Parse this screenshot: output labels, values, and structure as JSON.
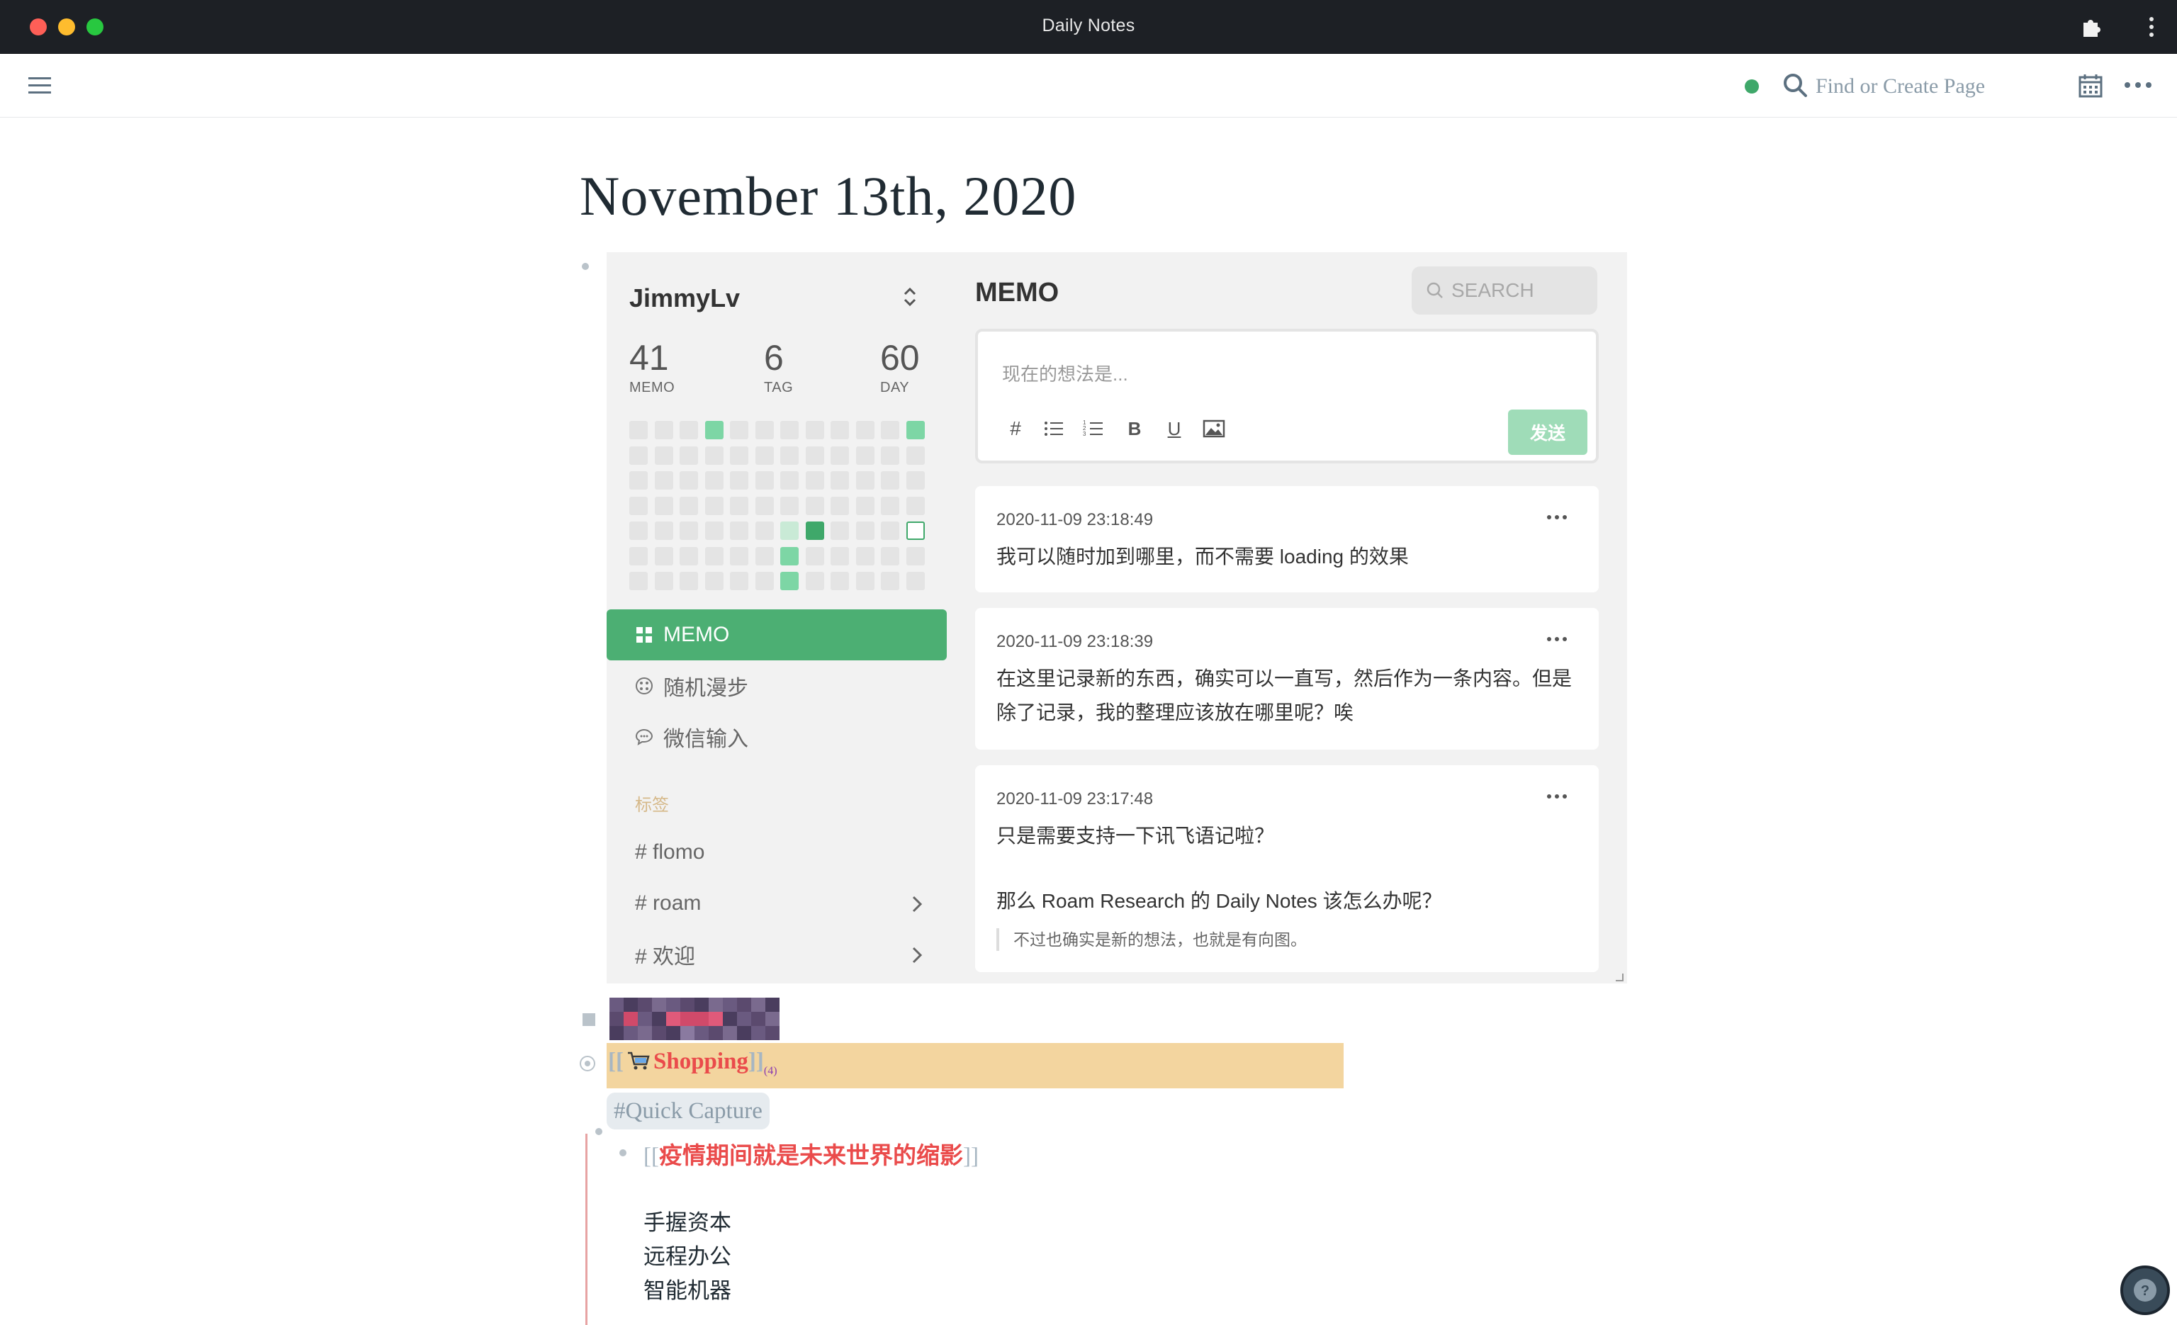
{
  "window": {
    "title": "Daily Notes"
  },
  "topbar": {
    "search_placeholder": "Find or Create Page"
  },
  "page": {
    "title": "November 13th, 2020"
  },
  "flomo": {
    "user": "JimmyLv",
    "stats": [
      {
        "value": "41",
        "label": "MEMO"
      },
      {
        "value": "6",
        "label": "TAG"
      },
      {
        "value": "60",
        "label": "DAY"
      }
    ],
    "heatmap": {
      "rows": 7,
      "cols": 12,
      "cells": [
        [
          0,
          0,
          0,
          2,
          0,
          0,
          0,
          0,
          0,
          0,
          0,
          2
        ],
        [
          0,
          0,
          0,
          0,
          0,
          0,
          0,
          0,
          0,
          0,
          0,
          0
        ],
        [
          0,
          0,
          0,
          0,
          0,
          0,
          0,
          0,
          0,
          0,
          0,
          0
        ],
        [
          0,
          0,
          0,
          0,
          0,
          0,
          0,
          0,
          0,
          0,
          0,
          0
        ],
        [
          0,
          0,
          0,
          0,
          0,
          0,
          1,
          3,
          0,
          0,
          0,
          -1
        ],
        [
          0,
          0,
          0,
          0,
          0,
          0,
          2,
          0,
          0,
          0,
          0,
          0
        ],
        [
          0,
          0,
          0,
          0,
          0,
          0,
          2,
          0,
          0,
          0,
          0,
          0
        ]
      ]
    },
    "nav": [
      {
        "label": "MEMO",
        "icon": "grid-icon",
        "active": true
      },
      {
        "label": "随机漫步",
        "icon": "dice-icon",
        "active": false
      },
      {
        "label": "微信输入",
        "icon": "chat-bubble-icon",
        "active": false
      }
    ],
    "tags_heading": "标签",
    "tags": [
      {
        "label": "# flomo",
        "has_children": false
      },
      {
        "label": "# roam",
        "has_children": true
      },
      {
        "label": "# 欢迎",
        "has_children": true
      }
    ],
    "memo_heading": "MEMO",
    "search_placeholder": "SEARCH",
    "composer": {
      "placeholder": "现在的想法是...",
      "tools": [
        {
          "icon": "hashtag-icon",
          "glyph": "#"
        },
        {
          "icon": "bullet-list-icon",
          "glyph": "☰"
        },
        {
          "icon": "numbered-list-icon",
          "glyph": "☷"
        },
        {
          "icon": "bold-icon",
          "glyph": "B"
        },
        {
          "icon": "underline-icon",
          "glyph": "U"
        },
        {
          "icon": "image-icon",
          "glyph": ""
        }
      ],
      "send_label": "发送"
    },
    "memos": [
      {
        "time": "2020-11-09 23:18:49",
        "lines": [
          "我可以随时加到哪里，而不需要 loading 的效果"
        ]
      },
      {
        "time": "2020-11-09 23:18:39",
        "lines": [
          "在这里记录新的东西，确实可以一直写，然后作为一条内容。但是",
          "除了记录，我的整理应该放在哪里呢？唉"
        ]
      },
      {
        "time": "2020-11-09 23:17:48",
        "lines": [
          "只是需要支持一下讯飞语记啦？",
          "",
          "那么 Roam Research 的 Daily Notes 该怎么办呢？"
        ],
        "quote": "不过也确实是新的想法，也就是有向图。"
      }
    ]
  },
  "blocks": {
    "shopping": {
      "open": "[[",
      "label": "Shopping",
      "close": "]]",
      "footnote": "(4)"
    },
    "quick_capture": "#Quick Capture",
    "sub_link": {
      "open": "[[",
      "label": "疫情期间就是未来世界的缩影",
      "close": "]]"
    },
    "sub_lines": [
      "手握资本",
      "远程办公",
      "智能机器"
    ]
  },
  "colors": {
    "accent": "#4caf73",
    "link": "#ea4b4b",
    "highlight": "#f3d59f",
    "tag_label": "#d6b98a"
  }
}
